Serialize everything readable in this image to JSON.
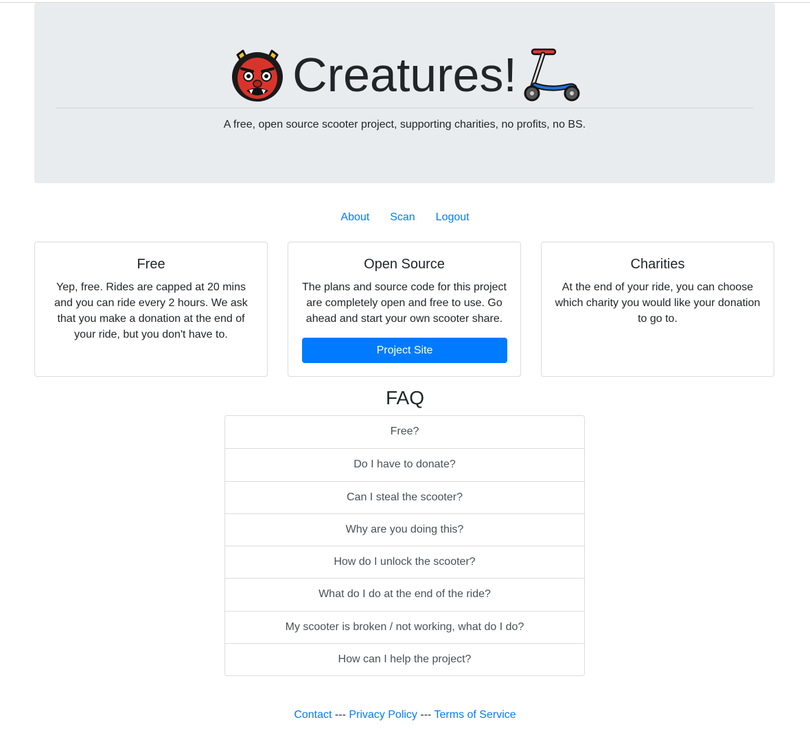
{
  "header": {
    "title": "Creatures!",
    "left_emoji": "ogre-icon",
    "right_emoji": "kick-scooter-icon",
    "tagline": "A free, open source scooter project, supporting charities, no profits, no BS."
  },
  "nav": {
    "items": [
      {
        "label": "About"
      },
      {
        "label": "Scan"
      },
      {
        "label": "Logout"
      }
    ]
  },
  "cards": [
    {
      "title": "Free",
      "text": "Yep, free. Rides are capped at 20 mins and you can ride every 2 hours. We ask that you make a donation at the end of your ride, but you don't have to."
    },
    {
      "title": "Open Source",
      "text": "The plans and source code for this project are completely open and free to use. Go ahead and start your own scooter share.",
      "button_label": "Project Site"
    },
    {
      "title": "Charities",
      "text": "At the end of your ride, you can choose which charity you would like your donation to go to."
    }
  ],
  "faq": {
    "title": "FAQ",
    "items": [
      "Free?",
      "Do I have to donate?",
      "Can I steal the scooter?",
      "Why are you doing this?",
      "How do I unlock the scooter?",
      "What do I do at the end of the ride?",
      "My scooter is broken / not working, what do I do?",
      "How can I help the project?"
    ]
  },
  "footer": {
    "contact": "Contact",
    "sep1": " --- ",
    "privacy": "Privacy Policy",
    "sep2": " --- ",
    "terms": "Terms of Service"
  },
  "colors": {
    "link": "#007bff",
    "jumbotron_bg": "#e9ecef",
    "button_bg": "#007bff"
  }
}
